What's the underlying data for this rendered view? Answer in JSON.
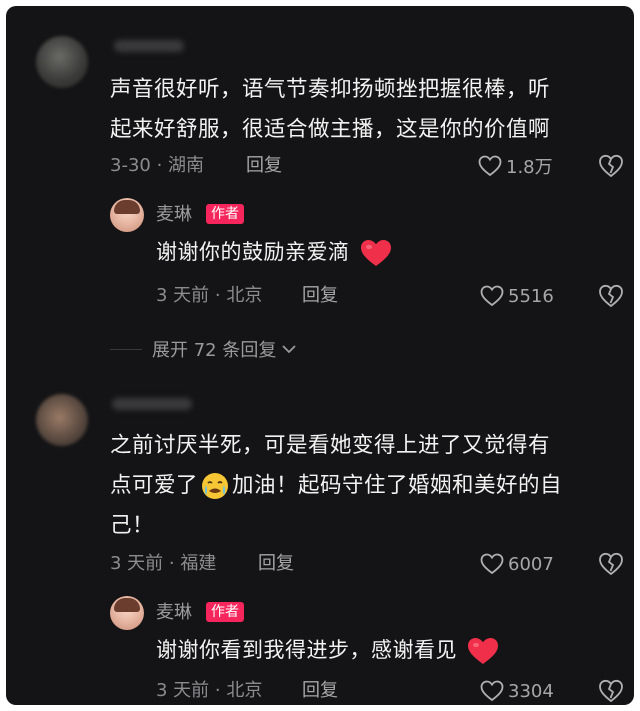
{
  "comments": [
    {
      "text_lines": [
        "声音很好听，语气节奏抑扬顿挫把握很棒，听",
        "起来好舒服，很适合做主播，这是你的价值啊"
      ],
      "meta": "3-30 · 湖南",
      "reply_label": "回复",
      "likes": "1.8万",
      "author_reply": {
        "name": "麦琳",
        "badge": "作者",
        "text": "谢谢你的鼓励亲爱滴",
        "emoji": "red-heart",
        "meta": "3 天前 · 北京",
        "reply_label": "回复",
        "likes": "5516"
      },
      "expand_label": "展开 72 条回复"
    },
    {
      "text_lines": [
        "之前讨厌半死，可是看她变得上进了又觉得有",
        "点可爱了",
        "加油！起码守住了婚姻和美好的自",
        "己！"
      ],
      "text_emoji": "crying-face",
      "meta": "3 天前 · 福建",
      "reply_label": "回复",
      "likes": "6007",
      "author_reply": {
        "name": "麦琳",
        "badge": "作者",
        "text": "谢谢你看到我得进步，感谢看见",
        "emoji": "red-heart",
        "meta": "3 天前 · 北京",
        "reply_label": "回复",
        "likes": "3304"
      }
    }
  ],
  "colors": {
    "background": "#141416",
    "badge": "#f6265c",
    "heart": "#f0304a"
  }
}
